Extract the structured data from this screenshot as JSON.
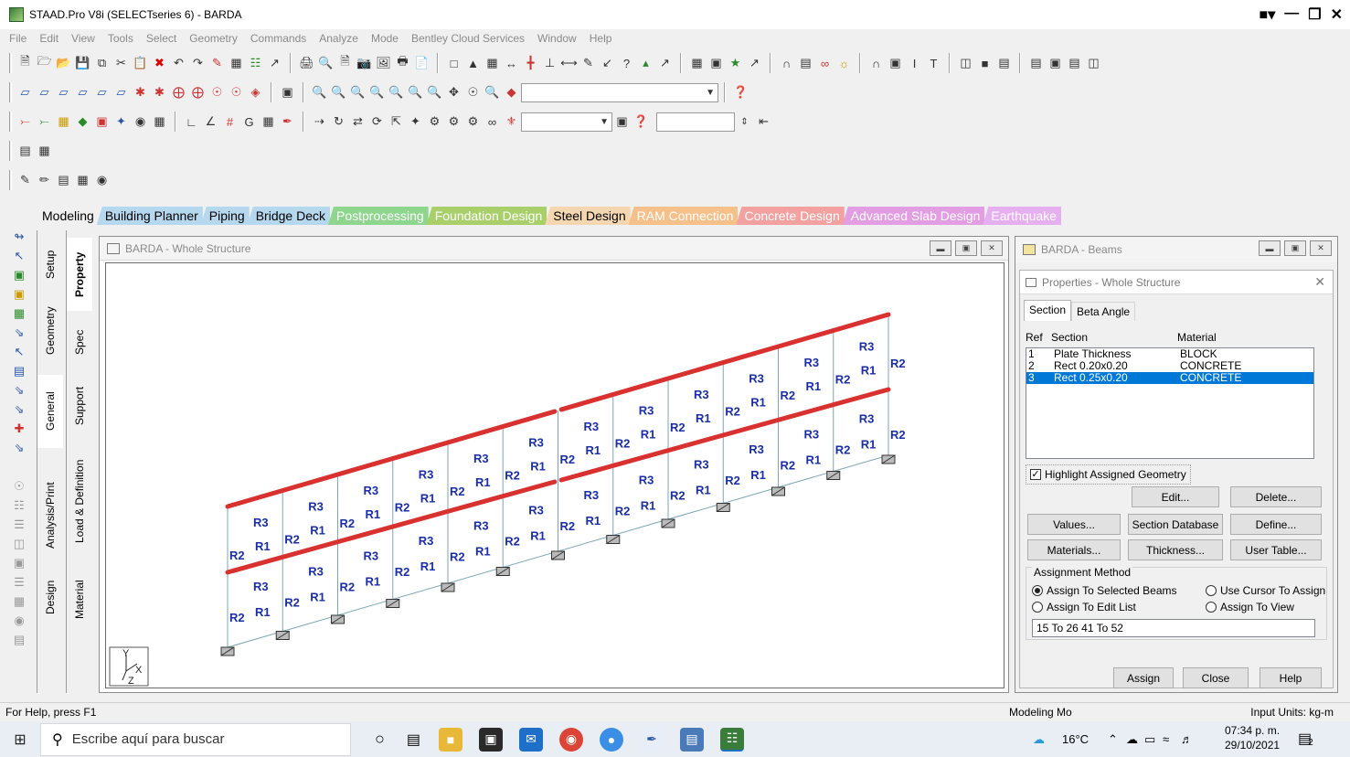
{
  "window": {
    "title": "STAAD.Pro V8i (SELECTseries 6) - BARDA"
  },
  "menu": [
    "File",
    "Edit",
    "View",
    "Tools",
    "Select",
    "Geometry",
    "Commands",
    "Analyze",
    "Mode",
    "Bentley Cloud Services",
    "Window",
    "Help"
  ],
  "page_tabs": [
    {
      "label": "Modeling",
      "bg": "#f0f0f0",
      "fg": "#000000"
    },
    {
      "label": "Building Planner",
      "bg": "#b6d8ee",
      "fg": "#000000"
    },
    {
      "label": "Piping",
      "bg": "#b6d8ee",
      "fg": "#000000"
    },
    {
      "label": "Bridge Deck",
      "bg": "#b6d8ee",
      "fg": "#000000"
    },
    {
      "label": "Postprocessing",
      "bg": "#8ed68e",
      "fg": "#ffffff"
    },
    {
      "label": "Foundation Design",
      "bg": "#a8cf6a",
      "fg": "#ffffff"
    },
    {
      "label": "Steel Design",
      "bg": "#f4d7b0",
      "fg": "#000000"
    },
    {
      "label": "RAM Connection",
      "bg": "#f6c08a",
      "fg": "#ffffff"
    },
    {
      "label": "Concrete Design",
      "bg": "#f2a0a0",
      "fg": "#ffffff"
    },
    {
      "label": "Advanced Slab Design",
      "bg": "#e39ee3",
      "fg": "#ffffff"
    },
    {
      "label": "Earthquake",
      "bg": "#e6b0f0",
      "fg": "#ffffff"
    }
  ],
  "vtabs_outer": [
    "Setup",
    "Geometry",
    "General",
    "Analysis/Print",
    "Design"
  ],
  "vtabs_inner": [
    "Property",
    "Spec",
    "Support",
    "Load & Definition",
    "Material"
  ],
  "main_window": {
    "title": "BARDA - Whole Structure"
  },
  "side_window": {
    "title": "BARDA - Beams"
  },
  "properties": {
    "title": "Properties - Whole Structure",
    "tabs": [
      "Section",
      "Beta Angle"
    ],
    "columns": [
      "Ref",
      "Section",
      "Material"
    ],
    "rows": [
      {
        "ref": "1",
        "section": "Plate Thickness",
        "material": "BLOCK"
      },
      {
        "ref": "2",
        "section": "Rect 0.20x0.20",
        "material": "CONCRETE"
      },
      {
        "ref": "3",
        "section": "Rect 0.25x0.20",
        "material": "CONCRETE"
      }
    ],
    "selected_row": "3",
    "highlight_label": "Highlight Assigned Geometry",
    "highlight_checked": true,
    "buttons": {
      "edit": "Edit...",
      "delete": "Delete...",
      "values": "Values...",
      "section_db": "Section Database",
      "define": "Define...",
      "materials": "Materials...",
      "thickness": "Thickness...",
      "user_table": "User Table..."
    },
    "assignment": {
      "legend": "Assignment Method",
      "opt_selected": "Assign To Selected Beams",
      "opt_cursor": "Use Cursor To Assign",
      "opt_edit_list": "Assign To Edit List",
      "opt_view": "Assign To View",
      "selected": "Assign To Selected Beams",
      "edit_list_value": "15 To 26 41 To 52"
    },
    "footer_buttons": {
      "assign": "Assign",
      "close": "Close",
      "help": "Help"
    }
  },
  "model": {
    "member_labels": [
      "R1",
      "R2",
      "R3"
    ],
    "label_color": "#1a2ea8",
    "highlight_color": "#d93030",
    "member_color": "#7aa6b8",
    "axis_triad": [
      "Y",
      "X",
      "Z"
    ]
  },
  "statusbar": {
    "help": "For Help, press F1",
    "mode": "Modeling Mo",
    "units": "Input Units:  kg-m"
  },
  "taskbar": {
    "search_placeholder": "Escribe aquí para buscar",
    "temperature": "16°C",
    "time": "07:34 p. m.",
    "date": "29/10/2021",
    "notifications": "2"
  }
}
